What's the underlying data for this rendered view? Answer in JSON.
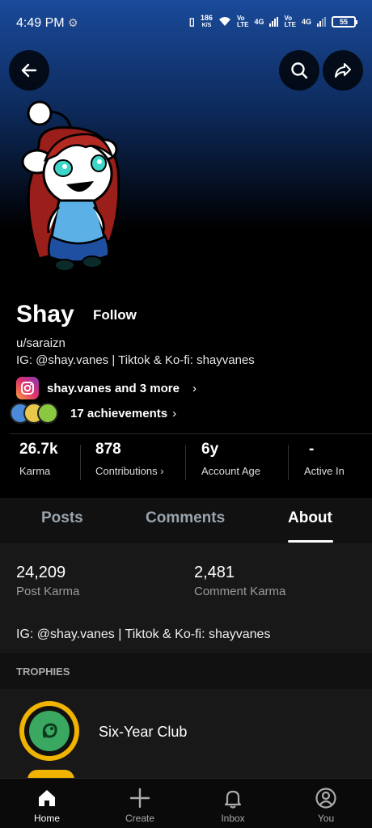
{
  "status_bar": {
    "time": "4:49 PM",
    "network_speed_value": "186",
    "network_speed_unit": "K/S",
    "sim1_label": "Vo\nLTE",
    "sim1_type": "4G",
    "sim2_label": "Vo\nLTE",
    "sim2_type": "4G",
    "battery": "55"
  },
  "profile": {
    "display_name": "Shay",
    "follow_label": "Follow",
    "username": "u/saraizn",
    "bio": "IG: @shay.vanes | Tiktok & Ko-fi: shayvanes",
    "social_links": "shay.vanes and 3 more",
    "achievements": "17 achievements"
  },
  "stats": [
    {
      "value": "26.7k",
      "label": "Karma"
    },
    {
      "value": "878",
      "label": "Contributions"
    },
    {
      "value": "6y",
      "label": "Account Age"
    },
    {
      "value": "-",
      "label": "Active In"
    }
  ],
  "tabs": [
    {
      "label": "Posts"
    },
    {
      "label": "Comments"
    },
    {
      "label": "About"
    }
  ],
  "active_tab": "About",
  "about": {
    "post_karma_value": "24,209",
    "post_karma_label": "Post Karma",
    "comment_karma_value": "2,481",
    "comment_karma_label": "Comment Karma",
    "bio": "IG: @shay.vanes | Tiktok & Ko-fi: shayvanes",
    "trophies_heading": "TROPHIES",
    "trophies": [
      {
        "name": "Six-Year Club"
      }
    ]
  },
  "bottom_nav": [
    {
      "label": "Home",
      "icon": "home-icon"
    },
    {
      "label": "Create",
      "icon": "plus-icon"
    },
    {
      "label": "Inbox",
      "icon": "bell-icon"
    },
    {
      "label": "You",
      "icon": "profile-icon"
    }
  ],
  "colors": {
    "header_gradient_top": "#1a4a9a",
    "trophy_gold": "#f0b400",
    "background": "#000000"
  }
}
